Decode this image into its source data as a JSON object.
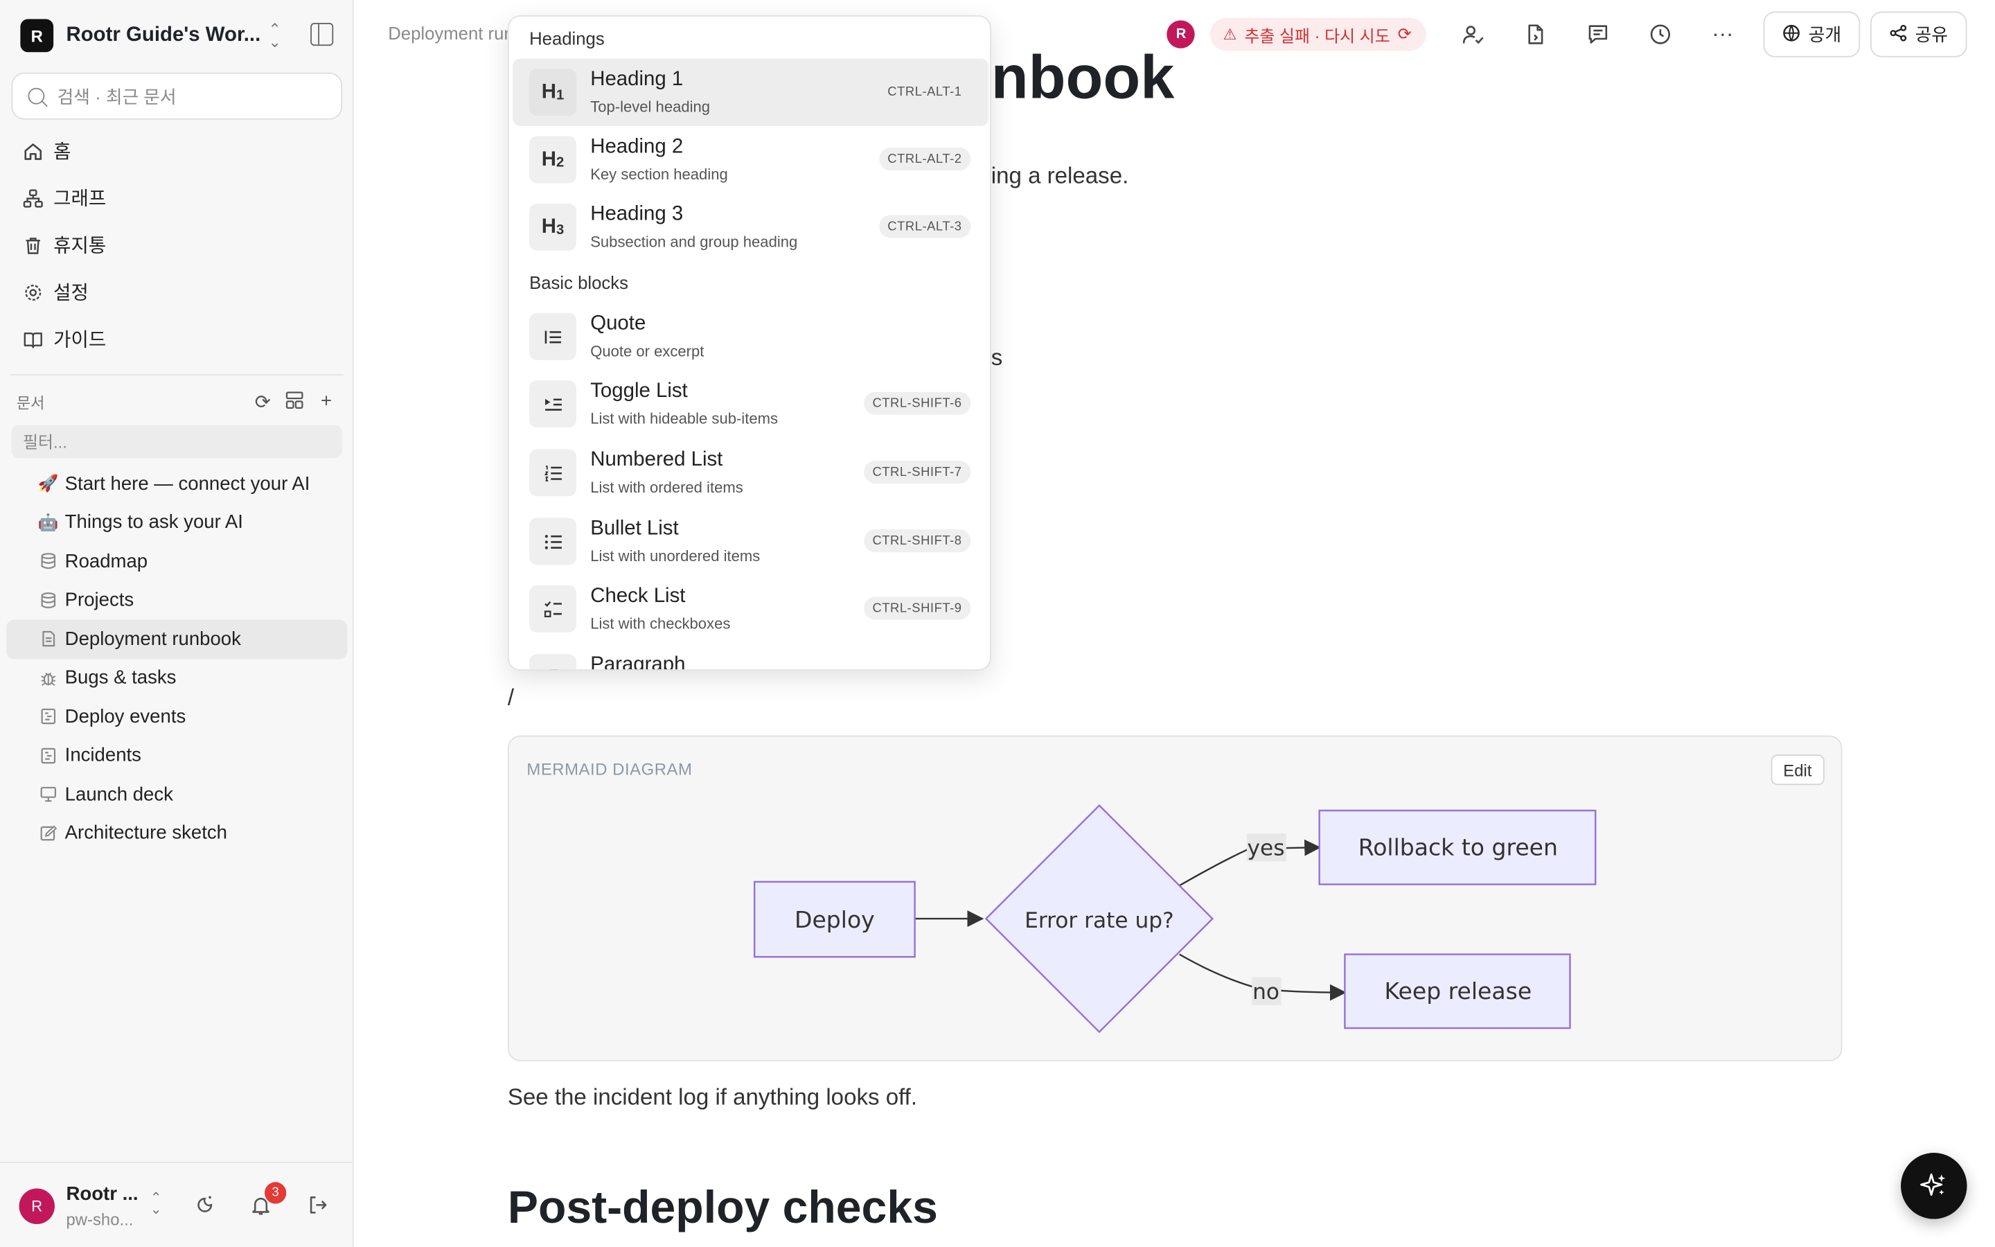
{
  "workspace": {
    "avatar": "R",
    "name": "Rootr Guide's Wor..."
  },
  "search": {
    "placeholder": "검색 · 최근 문서"
  },
  "nav": [
    {
      "icon": "home-icon",
      "label": "홈"
    },
    {
      "icon": "graph-icon",
      "label": "그래프"
    },
    {
      "icon": "trash-icon",
      "label": "휴지통"
    },
    {
      "icon": "gear-icon",
      "label": "설정"
    },
    {
      "icon": "book-icon",
      "label": "가이드"
    }
  ],
  "docs": {
    "section_label": "문서",
    "filter_placeholder": "필터...",
    "items": [
      {
        "icon": "🚀",
        "label": "Start here — connect your AI",
        "active": false
      },
      {
        "icon": "🤖",
        "label": "Things to ask your AI",
        "active": false
      },
      {
        "icon": "database-icon",
        "label": "Roadmap",
        "active": false
      },
      {
        "icon": "database-icon",
        "label": "Projects",
        "active": false
      },
      {
        "icon": "document-icon",
        "label": "Deployment runbook",
        "active": true
      },
      {
        "icon": "bug-icon",
        "label": "Bugs & tasks",
        "active": false
      },
      {
        "icon": "timeline-icon",
        "label": "Deploy events",
        "active": false
      },
      {
        "icon": "timeline-icon",
        "label": "Incidents",
        "active": false
      },
      {
        "icon": "presentation-icon",
        "label": "Launch deck",
        "active": false
      },
      {
        "icon": "sketch-icon",
        "label": "Architecture sketch",
        "active": false
      }
    ]
  },
  "user": {
    "avatar": "R",
    "name": "Rootr ...",
    "sub": "pw-sho...",
    "notifications": "3"
  },
  "topbar": {
    "breadcrumb": "Deployment runbook",
    "presence_avatar": "R",
    "extract_status": "추출 실패 · 다시 시도",
    "public_label": "공개",
    "share_label": "공유"
  },
  "editor": {
    "title": "Deployment runbook",
    "title_visible": "nbook",
    "intro_visible": "ing a release.",
    "partial_line": "ys",
    "slash_line": "/",
    "after_diagram": "See the incident log if anything looks off.",
    "section_heading": "Post-deploy checks"
  },
  "mermaid": {
    "label": "MERMAID DIAGRAM",
    "edit_label": "Edit",
    "nodes": {
      "deploy": "Deploy",
      "decision": "Error rate up?",
      "rollback": "Rollback to green",
      "keep": "Keep release"
    },
    "edges": {
      "yes": "yes",
      "no": "no"
    },
    "colors": {
      "node_fill": "#ececff",
      "node_stroke": "#9370db",
      "edge_label_bg": "#e8e8e8"
    }
  },
  "slash_menu": {
    "sections": [
      {
        "label": "Headings",
        "items": [
          {
            "icon": "H1",
            "title": "Heading 1",
            "desc": "Top-level heading",
            "shortcut": "CTRL-ALT-1",
            "active": true
          },
          {
            "icon": "H2",
            "title": "Heading 2",
            "desc": "Key section heading",
            "shortcut": "CTRL-ALT-2"
          },
          {
            "icon": "H3",
            "title": "Heading 3",
            "desc": "Subsection and group heading",
            "shortcut": "CTRL-ALT-3"
          }
        ]
      },
      {
        "label": "Basic blocks",
        "items": [
          {
            "icon": "quote-icon",
            "title": "Quote",
            "desc": "Quote or excerpt",
            "shortcut": ""
          },
          {
            "icon": "toggle-list-icon",
            "title": "Toggle List",
            "desc": "List with hideable sub-items",
            "shortcut": "CTRL-SHIFT-6"
          },
          {
            "icon": "numbered-list-icon",
            "title": "Numbered List",
            "desc": "List with ordered items",
            "shortcut": "CTRL-SHIFT-7"
          },
          {
            "icon": "bullet-list-icon",
            "title": "Bullet List",
            "desc": "List with unordered items",
            "shortcut": "CTRL-SHIFT-8"
          },
          {
            "icon": "check-list-icon",
            "title": "Check List",
            "desc": "List with checkboxes",
            "shortcut": "CTRL-SHIFT-9"
          },
          {
            "icon": "paragraph-icon",
            "title": "Paragraph",
            "desc": "",
            "shortcut": ""
          }
        ]
      }
    ]
  }
}
